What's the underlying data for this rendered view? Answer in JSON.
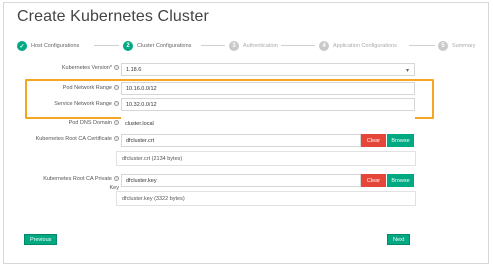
{
  "title": "Create Kubernetes Cluster",
  "steps": [
    {
      "num": "✓",
      "label": "Host Configurations",
      "state": "done"
    },
    {
      "num": "2",
      "label": "Cluster Configurations",
      "state": "active"
    },
    {
      "num": "3",
      "label": "Authentication",
      "state": "pending"
    },
    {
      "num": "4",
      "label": "Application Configurations",
      "state": "pending"
    },
    {
      "num": "5",
      "label": "Summary",
      "state": "pending"
    }
  ],
  "form": {
    "k8s_version_label": "Kubernetes Version*",
    "k8s_version_value": "1.18.6",
    "pod_network_label": "Pod Network Range",
    "pod_network_value": "10.16.0.0/12",
    "service_network_label": "Service Network Range",
    "service_network_value": "10.32.0.0/12",
    "pod_dns_label": "Pod DNS Domain",
    "pod_dns_value": "cluster.local",
    "ca_cert_label": "Kubernetes Root CA Certificate",
    "ca_cert_file": "dfcluster.crt",
    "ca_cert_info": "dfcluster.crt (2134 bytes)",
    "ca_key_label_1": "Kubernetes Root CA Private",
    "ca_key_label_2": "Key",
    "ca_key_file": "dfcluster.key",
    "ca_key_info": "dfcluster.key (3322 bytes)",
    "clear_label": "Clear",
    "browse_label": "Browse"
  },
  "footer": {
    "previous_label": "Previous",
    "next_label": "Next"
  },
  "colors": {
    "accent": "#01a982",
    "clear": "#e5463a",
    "highlight": "#f5a623"
  }
}
